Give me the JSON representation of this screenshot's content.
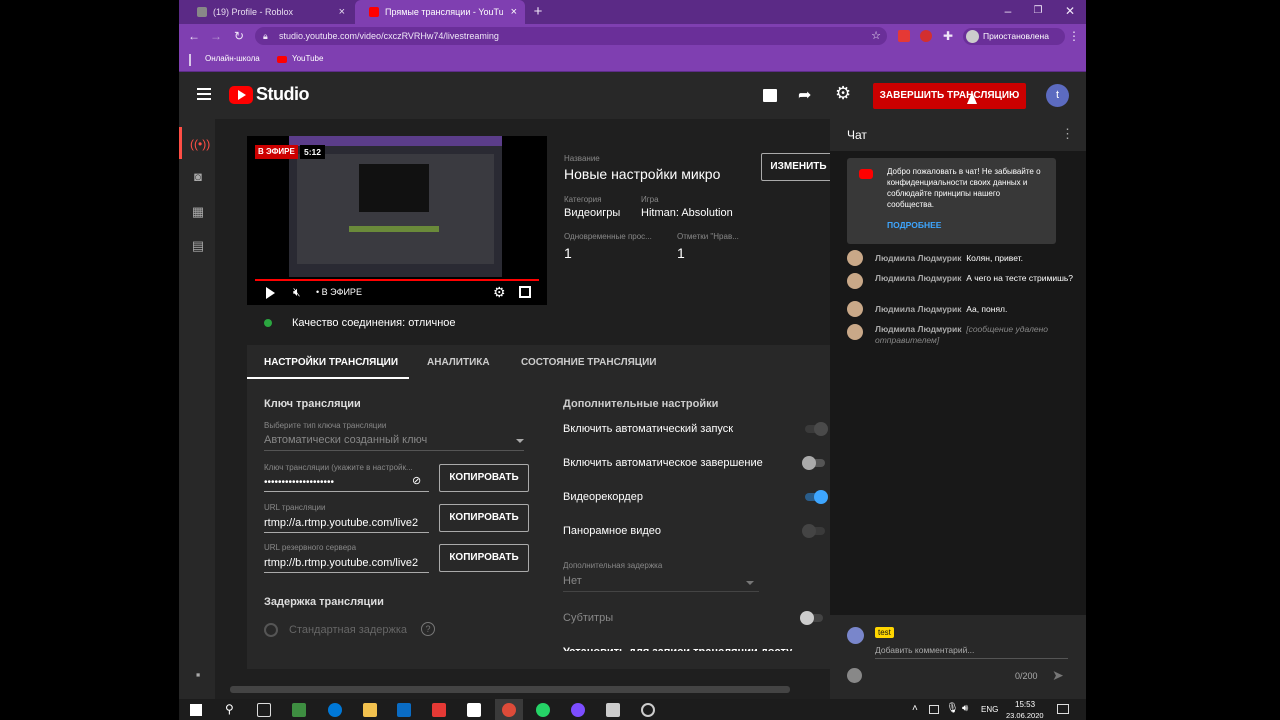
{
  "browser": {
    "tabs": [
      {
        "title": "(19) Profile - Roblox",
        "active": false
      },
      {
        "title": "Прямые трансляции - YouTube",
        "active": true
      }
    ],
    "url": "studio.youtube.com/video/cxczRVRHw74/livestreaming",
    "profile_label": "Приостановлена",
    "bookmarks": [
      "Онлайн-школа",
      "YouTube"
    ]
  },
  "studio": {
    "logo_text": "Studio",
    "end_stream_label": "ЗАВЕРШИТЬ ТРАНСЛЯЦИЮ",
    "avatar_letter": "t"
  },
  "preview": {
    "live_badge": "В ЭФИРЕ",
    "duration": "5:12",
    "live_control": "• В ЭФИРЕ"
  },
  "stream_info": {
    "title_label": "Название",
    "title": "Новые настройки микро",
    "edit_label": "ИЗМЕНИТЬ",
    "category_label": "Категория",
    "category": "Видеоигры",
    "game_label": "Игра",
    "game": "Hitman: Absolution",
    "concurrent_label": "Одновременные прос...",
    "concurrent": "1",
    "likes_label": "Отметки \"Нрав...",
    "likes": "1",
    "connection": "Качество соединения: отличное"
  },
  "tabs": [
    "НАСТРОЙКИ ТРАНСЛЯЦИИ",
    "АНАЛИТИКА",
    "СОСТОЯНИЕ ТРАНСЛЯЦИИ"
  ],
  "key_section": {
    "heading": "Ключ трансляции",
    "type_label": "Выберите тип ключа трансляции",
    "type_value": "Автоматически созданный ключ",
    "key_label": "Ключ трансляции (укажите в настройк...",
    "key_value": "••••••••••••••••••••",
    "url_label": "URL трансляции",
    "url_value": "rtmp://a.rtmp.youtube.com/live2",
    "backup_label": "URL резервного сервера",
    "backup_value": "rtmp://b.rtmp.youtube.com/live2",
    "copy_label": "КОПИРОВАТЬ",
    "delay_heading": "Задержка трансляции",
    "delay_option": "Стандартная задержка"
  },
  "extra_settings": {
    "heading": "Дополнительные настройки",
    "toggles": [
      {
        "label": "Включить автоматический запуск",
        "on": false
      },
      {
        "label": "Включить автоматическое завершение",
        "on": false
      },
      {
        "label": "Видеорекордер",
        "on": true
      },
      {
        "label": "Панорамное видео",
        "on": false
      }
    ],
    "extra_delay_label": "Дополнительная задержка",
    "extra_delay_value": "Нет",
    "subtitles_label": "Субтитры",
    "cutoff_label": "Установить для записи трансляции доступ..."
  },
  "chat": {
    "title": "Чат",
    "welcome": "Добро пожаловать в чат! Не забывайте о конфиденциальности своих данных и соблюдайте принципы нашего сообщества.",
    "learn_more": "ПОДРОБНЕЕ",
    "messages": [
      {
        "author": "Людмила Людмурик",
        "text": "Колян, привет."
      },
      {
        "author": "Людмила Людмурик",
        "text": "А чего на тесте стримишь?"
      },
      {
        "author": "Людмила Людмурик",
        "text": "Аа, понял."
      },
      {
        "author": "Людмила Людмурик",
        "text": "[сообщение удалено отправителем]"
      }
    ],
    "input_user": "test",
    "placeholder": "Добавить комментарий...",
    "counter": "0/200"
  },
  "taskbar": {
    "lang": "ENG",
    "time": "15:53",
    "date": "23.06.2020"
  },
  "colors": {
    "accent_red": "#cc0000",
    "toggle_blue": "#3ea6ff",
    "browser_purple": "#7f3fb1"
  }
}
